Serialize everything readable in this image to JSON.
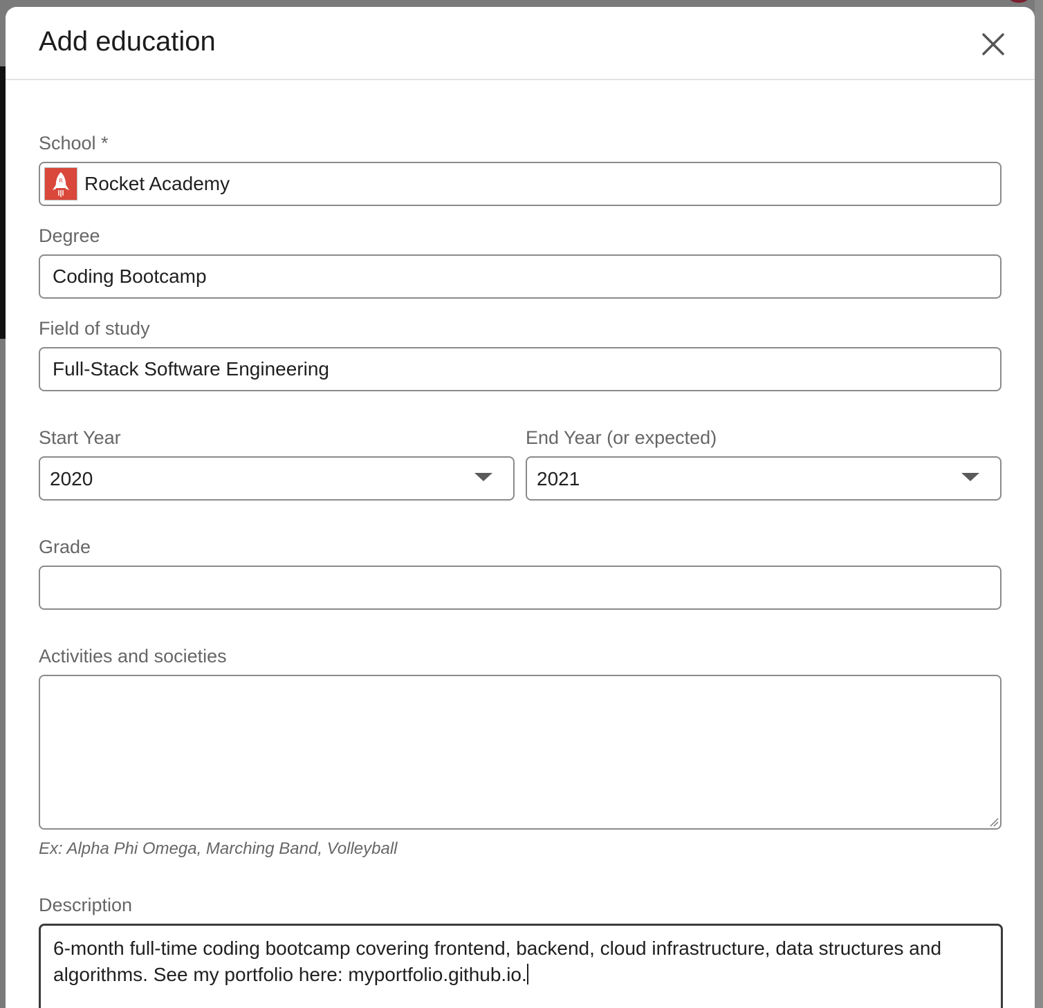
{
  "modal": {
    "title": "Add education",
    "close_icon": "close-icon"
  },
  "school": {
    "label": "School  *",
    "value": "Rocket Academy",
    "logo_icon": "rocket-academy-logo",
    "logo_color": "#d9483b"
  },
  "degree": {
    "label": "Degree",
    "value": "Coding Bootcamp"
  },
  "field_of_study": {
    "label": "Field of study",
    "value": "Full-Stack Software Engineering"
  },
  "start_year": {
    "label": "Start Year",
    "value": "2020"
  },
  "end_year": {
    "label": "End Year (or expected)",
    "value": "2021"
  },
  "grade": {
    "label": "Grade",
    "value": ""
  },
  "activities": {
    "label": "Activities and societies",
    "value": "",
    "hint": "Ex: Alpha Phi Omega, Marching Band, Volleyball"
  },
  "description": {
    "label": "Description",
    "value": "6-month full-time coding bootcamp covering frontend, backend, cloud infrastructure, data structures and algorithms. See my portfolio here: myportfolio.github.io."
  }
}
